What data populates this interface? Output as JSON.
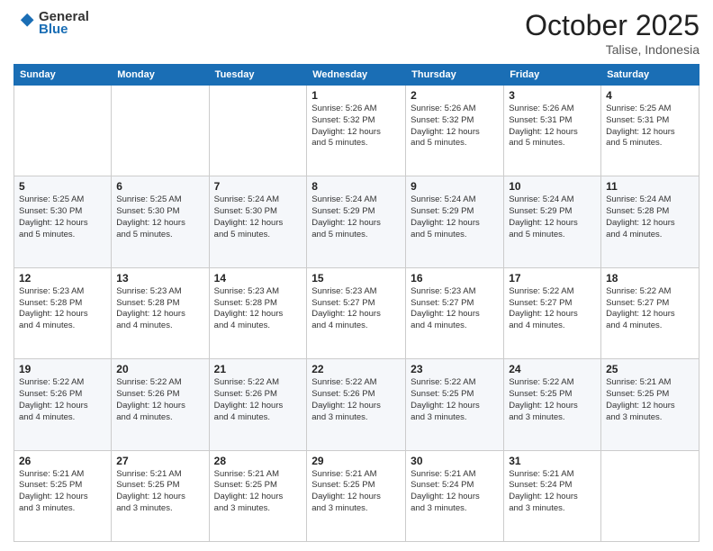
{
  "header": {
    "logo_line1": "General",
    "logo_line2": "Blue",
    "month": "October 2025",
    "location": "Talise, Indonesia"
  },
  "days_of_week": [
    "Sunday",
    "Monday",
    "Tuesday",
    "Wednesday",
    "Thursday",
    "Friday",
    "Saturday"
  ],
  "weeks": [
    [
      {
        "day": "",
        "info": ""
      },
      {
        "day": "",
        "info": ""
      },
      {
        "day": "",
        "info": ""
      },
      {
        "day": "1",
        "info": "Sunrise: 5:26 AM\nSunset: 5:32 PM\nDaylight: 12 hours\nand 5 minutes."
      },
      {
        "day": "2",
        "info": "Sunrise: 5:26 AM\nSunset: 5:32 PM\nDaylight: 12 hours\nand 5 minutes."
      },
      {
        "day": "3",
        "info": "Sunrise: 5:26 AM\nSunset: 5:31 PM\nDaylight: 12 hours\nand 5 minutes."
      },
      {
        "day": "4",
        "info": "Sunrise: 5:25 AM\nSunset: 5:31 PM\nDaylight: 12 hours\nand 5 minutes."
      }
    ],
    [
      {
        "day": "5",
        "info": "Sunrise: 5:25 AM\nSunset: 5:30 PM\nDaylight: 12 hours\nand 5 minutes."
      },
      {
        "day": "6",
        "info": "Sunrise: 5:25 AM\nSunset: 5:30 PM\nDaylight: 12 hours\nand 5 minutes."
      },
      {
        "day": "7",
        "info": "Sunrise: 5:24 AM\nSunset: 5:30 PM\nDaylight: 12 hours\nand 5 minutes."
      },
      {
        "day": "8",
        "info": "Sunrise: 5:24 AM\nSunset: 5:29 PM\nDaylight: 12 hours\nand 5 minutes."
      },
      {
        "day": "9",
        "info": "Sunrise: 5:24 AM\nSunset: 5:29 PM\nDaylight: 12 hours\nand 5 minutes."
      },
      {
        "day": "10",
        "info": "Sunrise: 5:24 AM\nSunset: 5:29 PM\nDaylight: 12 hours\nand 5 minutes."
      },
      {
        "day": "11",
        "info": "Sunrise: 5:24 AM\nSunset: 5:28 PM\nDaylight: 12 hours\nand 4 minutes."
      }
    ],
    [
      {
        "day": "12",
        "info": "Sunrise: 5:23 AM\nSunset: 5:28 PM\nDaylight: 12 hours\nand 4 minutes."
      },
      {
        "day": "13",
        "info": "Sunrise: 5:23 AM\nSunset: 5:28 PM\nDaylight: 12 hours\nand 4 minutes."
      },
      {
        "day": "14",
        "info": "Sunrise: 5:23 AM\nSunset: 5:28 PM\nDaylight: 12 hours\nand 4 minutes."
      },
      {
        "day": "15",
        "info": "Sunrise: 5:23 AM\nSunset: 5:27 PM\nDaylight: 12 hours\nand 4 minutes."
      },
      {
        "day": "16",
        "info": "Sunrise: 5:23 AM\nSunset: 5:27 PM\nDaylight: 12 hours\nand 4 minutes."
      },
      {
        "day": "17",
        "info": "Sunrise: 5:22 AM\nSunset: 5:27 PM\nDaylight: 12 hours\nand 4 minutes."
      },
      {
        "day": "18",
        "info": "Sunrise: 5:22 AM\nSunset: 5:27 PM\nDaylight: 12 hours\nand 4 minutes."
      }
    ],
    [
      {
        "day": "19",
        "info": "Sunrise: 5:22 AM\nSunset: 5:26 PM\nDaylight: 12 hours\nand 4 minutes."
      },
      {
        "day": "20",
        "info": "Sunrise: 5:22 AM\nSunset: 5:26 PM\nDaylight: 12 hours\nand 4 minutes."
      },
      {
        "day": "21",
        "info": "Sunrise: 5:22 AM\nSunset: 5:26 PM\nDaylight: 12 hours\nand 4 minutes."
      },
      {
        "day": "22",
        "info": "Sunrise: 5:22 AM\nSunset: 5:26 PM\nDaylight: 12 hours\nand 3 minutes."
      },
      {
        "day": "23",
        "info": "Sunrise: 5:22 AM\nSunset: 5:25 PM\nDaylight: 12 hours\nand 3 minutes."
      },
      {
        "day": "24",
        "info": "Sunrise: 5:22 AM\nSunset: 5:25 PM\nDaylight: 12 hours\nand 3 minutes."
      },
      {
        "day": "25",
        "info": "Sunrise: 5:21 AM\nSunset: 5:25 PM\nDaylight: 12 hours\nand 3 minutes."
      }
    ],
    [
      {
        "day": "26",
        "info": "Sunrise: 5:21 AM\nSunset: 5:25 PM\nDaylight: 12 hours\nand 3 minutes."
      },
      {
        "day": "27",
        "info": "Sunrise: 5:21 AM\nSunset: 5:25 PM\nDaylight: 12 hours\nand 3 minutes."
      },
      {
        "day": "28",
        "info": "Sunrise: 5:21 AM\nSunset: 5:25 PM\nDaylight: 12 hours\nand 3 minutes."
      },
      {
        "day": "29",
        "info": "Sunrise: 5:21 AM\nSunset: 5:25 PM\nDaylight: 12 hours\nand 3 minutes."
      },
      {
        "day": "30",
        "info": "Sunrise: 5:21 AM\nSunset: 5:24 PM\nDaylight: 12 hours\nand 3 minutes."
      },
      {
        "day": "31",
        "info": "Sunrise: 5:21 AM\nSunset: 5:24 PM\nDaylight: 12 hours\nand 3 minutes."
      },
      {
        "day": "",
        "info": ""
      }
    ]
  ]
}
